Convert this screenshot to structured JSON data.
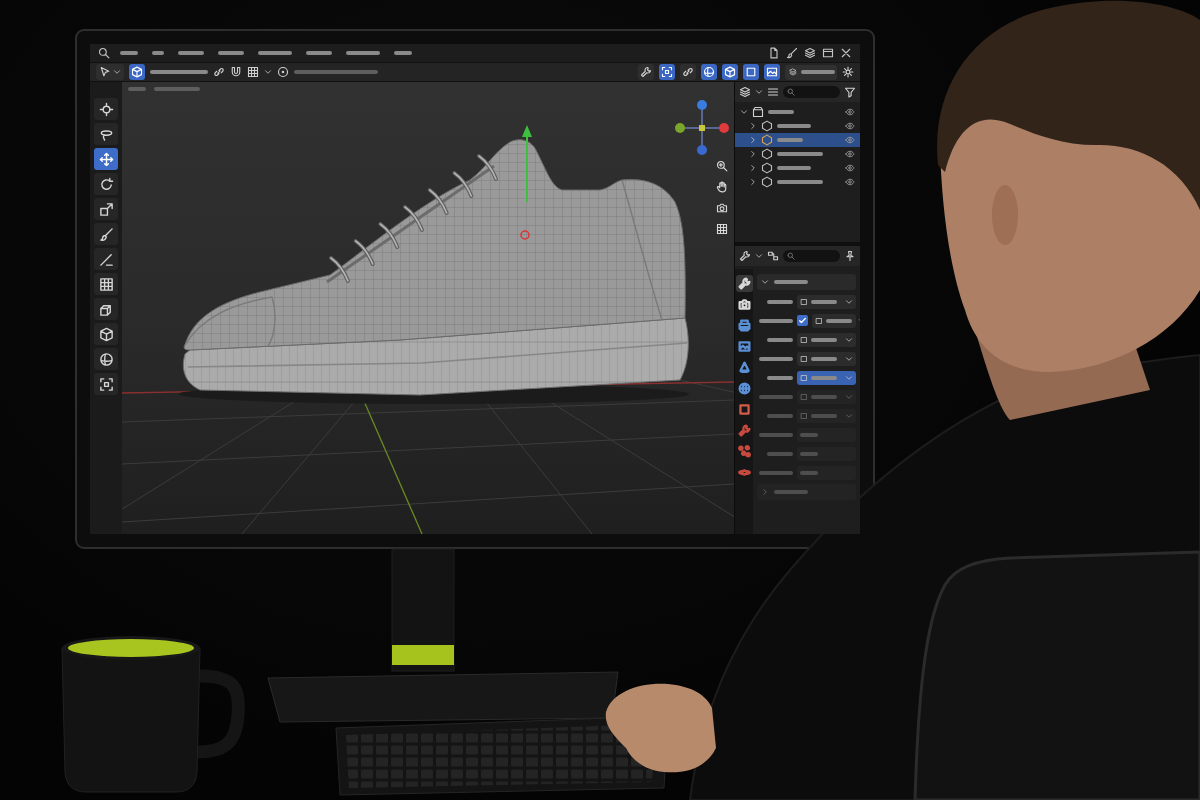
{
  "menu_bar": {
    "items": [
      {
        "selected": false
      },
      {
        "selected": false
      },
      {
        "selected": false
      },
      {
        "selected": false
      },
      {
        "selected": false
      },
      {
        "selected": false
      },
      {
        "selected": false
      },
      {
        "selected": false
      }
    ]
  },
  "header": {
    "mode_toggle": {
      "on": true
    },
    "toggles": [
      {
        "on": false
      },
      {
        "on": true
      },
      {
        "on": false
      },
      {
        "on": true
      },
      {
        "on": true
      },
      {
        "on": true
      },
      {
        "on": true
      }
    ]
  },
  "tools": [
    {
      "selected": false
    },
    {
      "selected": false
    },
    {
      "selected": true
    },
    {
      "selected": false
    },
    {
      "selected": false
    },
    {
      "selected": false
    },
    {
      "selected": false
    },
    {
      "selected": false
    },
    {
      "selected": false
    },
    {
      "selected": false
    },
    {
      "selected": false
    },
    {
      "selected": false
    }
  ],
  "outliner": {
    "items": [
      {
        "expanded": true,
        "selected": false,
        "visible": true,
        "children": [
          {
            "expanded": false,
            "selected": false,
            "visible": true
          },
          {
            "expanded": false,
            "selected": true,
            "visible": true
          },
          {
            "expanded": false,
            "selected": false,
            "visible": true
          },
          {
            "expanded": false,
            "selected": false,
            "visible": true
          },
          {
            "expanded": false,
            "selected": false,
            "visible": true
          }
        ]
      }
    ]
  },
  "properties": {
    "tabs": [
      {
        "selected": true,
        "color": "#d8d8d8"
      },
      {
        "selected": false,
        "color": "#d8d8d8"
      },
      {
        "selected": false,
        "color": "#5b8fd6"
      },
      {
        "selected": false,
        "color": "#5b8fd6"
      },
      {
        "selected": false,
        "color": "#5b8fd6"
      },
      {
        "selected": false,
        "color": "#5b8fd6"
      },
      {
        "selected": false,
        "color": "#d45a4a"
      },
      {
        "selected": false,
        "color": "#c84a3e"
      },
      {
        "selected": false,
        "color": "#c84a3e"
      },
      {
        "selected": false,
        "color": "#c84a3e"
      }
    ],
    "rows": [
      {
        "kind": "section",
        "expanded": true,
        "disabled": false
      },
      {
        "kind": "dropdown",
        "selected": false,
        "disabled": false
      },
      {
        "kind": "checkbox",
        "checked": true,
        "selected": false,
        "disabled": false
      },
      {
        "kind": "dropdown",
        "selected": false,
        "disabled": false
      },
      {
        "kind": "dropdown",
        "selected": false,
        "disabled": false
      },
      {
        "kind": "dropdown",
        "selected": true,
        "disabled": false
      },
      {
        "kind": "dropdown",
        "selected": false,
        "disabled": true
      },
      {
        "kind": "dropdown",
        "selected": false,
        "disabled": true
      },
      {
        "kind": "field",
        "selected": false,
        "disabled": true
      },
      {
        "kind": "field",
        "selected": false,
        "disabled": true
      },
      {
        "kind": "field",
        "selected": false,
        "disabled": true
      },
      {
        "kind": "section",
        "expanded": false,
        "disabled": true
      }
    ]
  }
}
